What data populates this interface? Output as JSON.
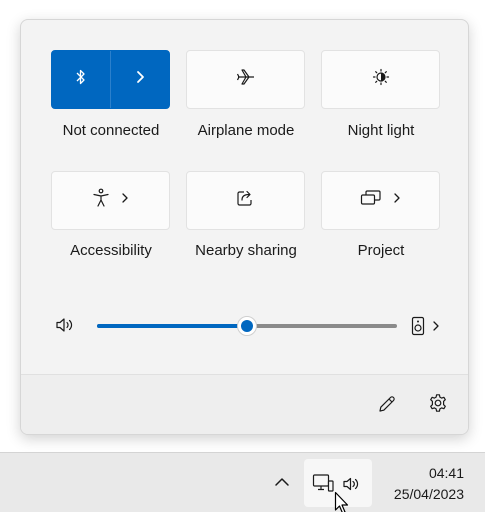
{
  "quick_settings": {
    "tiles": [
      {
        "label": "Not connected",
        "icon": "bluetooth-icon",
        "active": true
      },
      {
        "label": "Airplane mode",
        "icon": "airplane-icon",
        "active": false
      },
      {
        "label": "Night light",
        "icon": "brightness-icon",
        "active": false
      },
      {
        "label": "Accessibility",
        "icon": "accessibility-icon",
        "active": false
      },
      {
        "label": "Nearby sharing",
        "icon": "share-icon",
        "active": false
      },
      {
        "label": "Project",
        "icon": "project-icon",
        "active": false
      }
    ],
    "volume": {
      "level_percent": 50,
      "icon": "speaker-icon",
      "output_icon": "speaker-device-icon"
    },
    "footer": {
      "edit_icon": "pencil-icon",
      "settings_icon": "gear-icon"
    }
  },
  "taskbar": {
    "time": "04:41",
    "date": "25/04/2023",
    "tray_icons": [
      "chevron-up-icon",
      "network-icon",
      "volume-icon"
    ]
  },
  "colors": {
    "accent": "#0067c0"
  }
}
